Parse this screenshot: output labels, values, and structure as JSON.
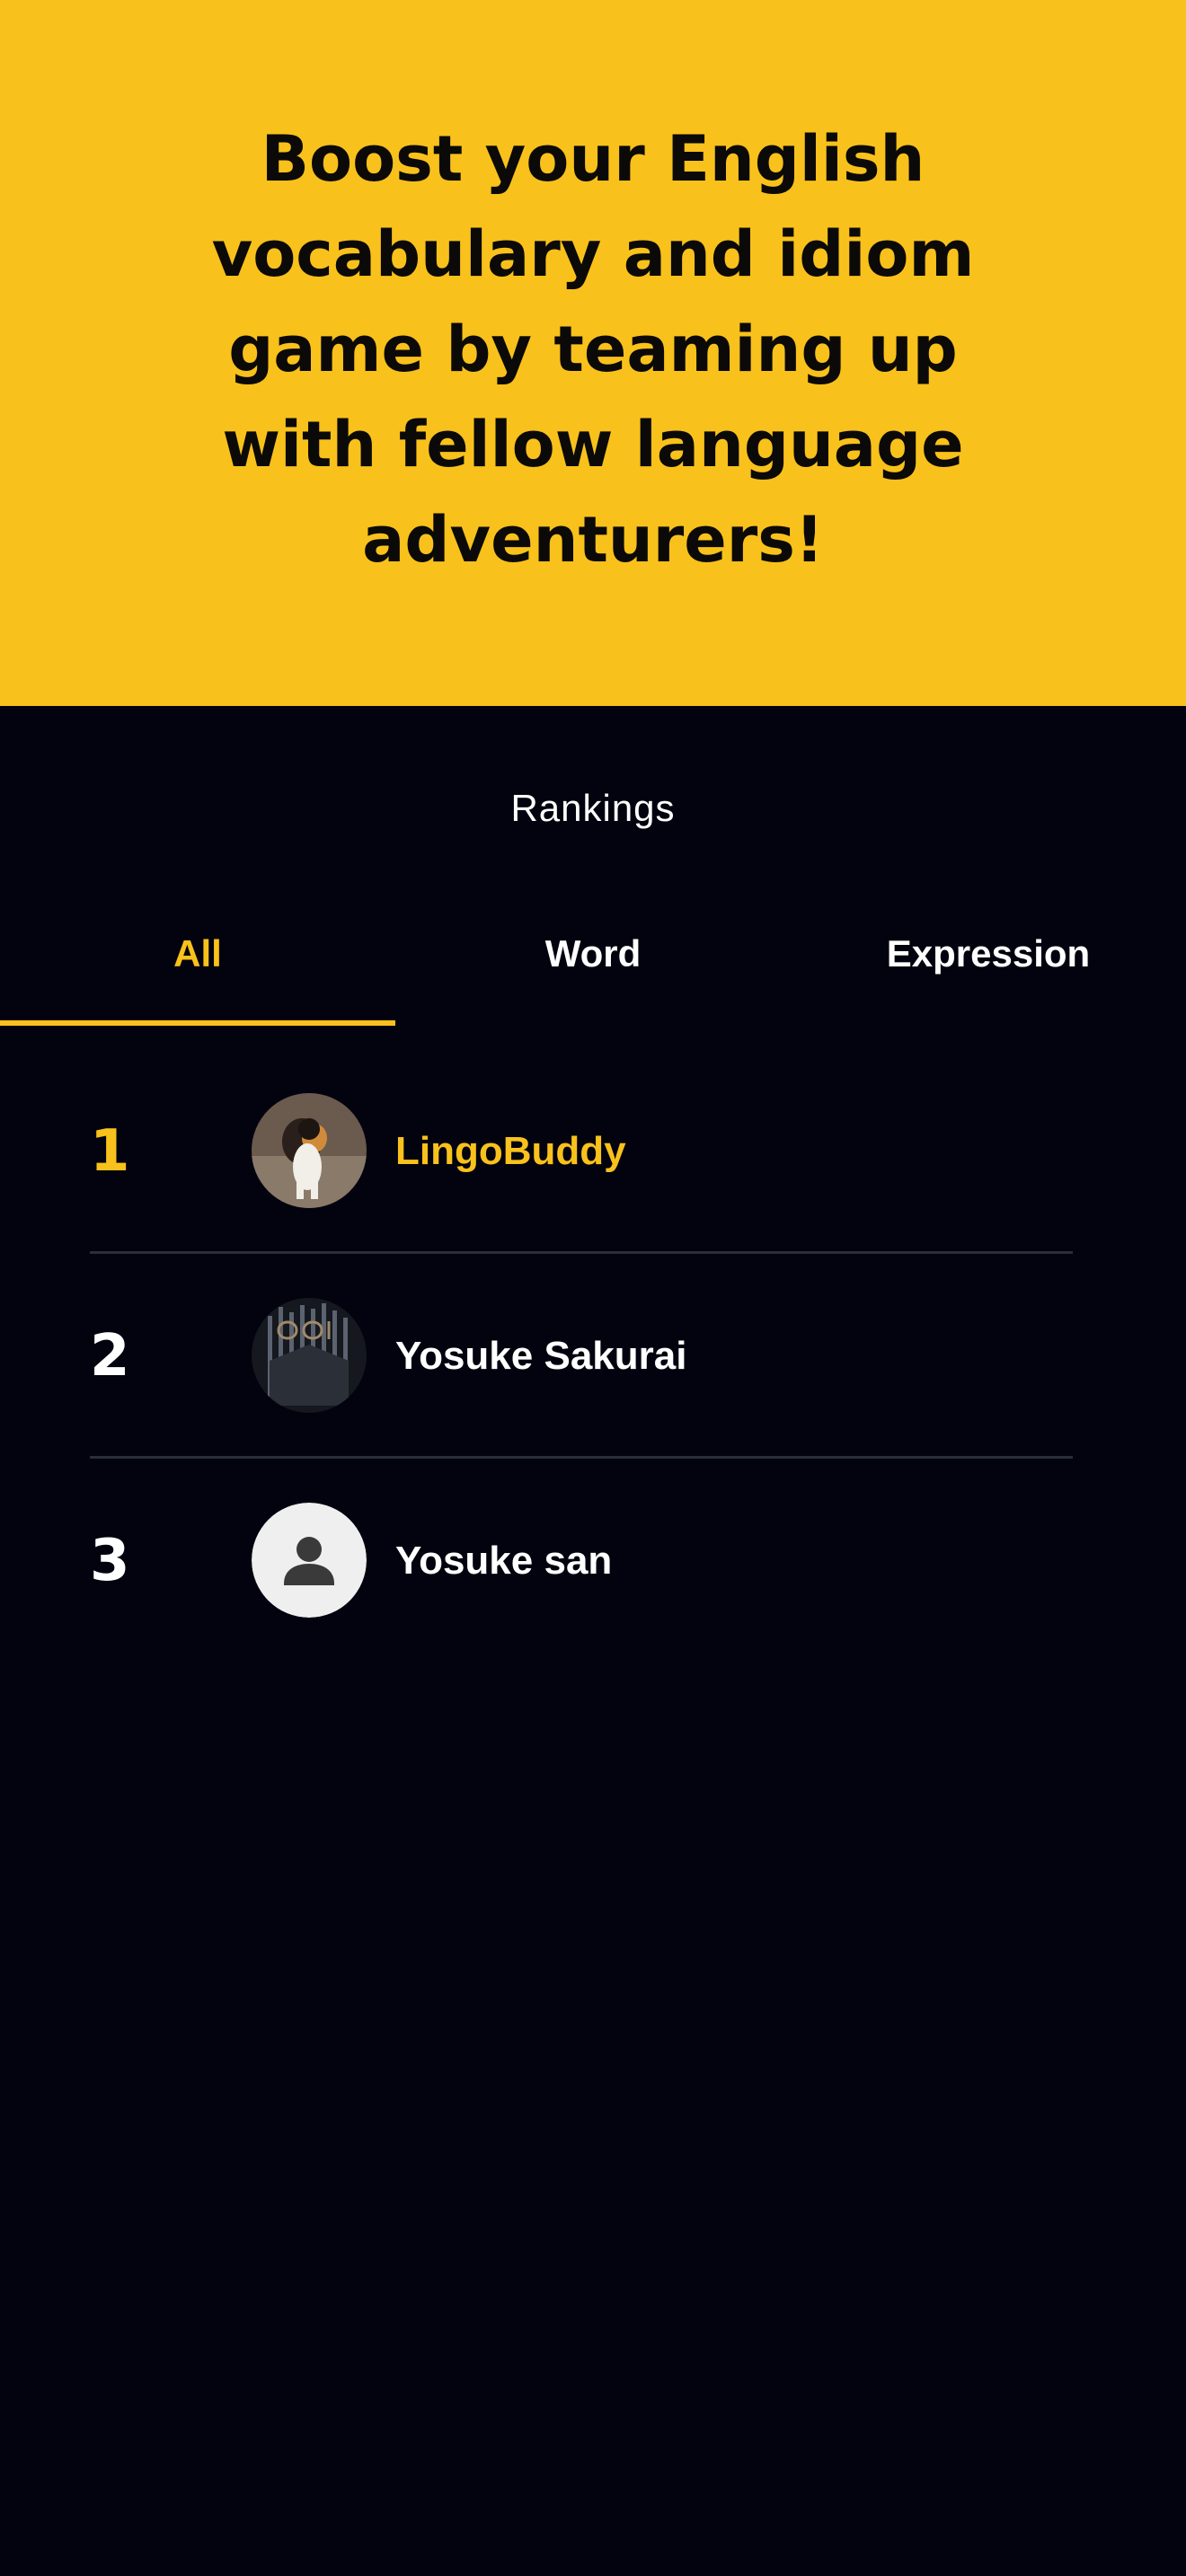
{
  "hero": {
    "title": "Boost your English vocabulary and idiom game by teaming up with fellow language adventurers!"
  },
  "rankings": {
    "title": "Rankings",
    "tabs": [
      {
        "label": "All",
        "active": true
      },
      {
        "label": "Word",
        "active": false
      },
      {
        "label": "Expression",
        "active": false
      }
    ],
    "entries": [
      {
        "rank": "1",
        "name": "LingoBuddy",
        "avatar": "cat-photo",
        "highlighted": true
      },
      {
        "rank": "2",
        "name": "Yosuke Sakurai",
        "avatar": "throne-photo",
        "highlighted": false
      },
      {
        "rank": "3",
        "name": "Yosuke san",
        "avatar": "person-icon",
        "highlighted": false
      }
    ]
  },
  "colors": {
    "accent": "#f9c11b",
    "background": "#03030f",
    "text": "#ffffff",
    "divider": "#2a2d3a"
  }
}
